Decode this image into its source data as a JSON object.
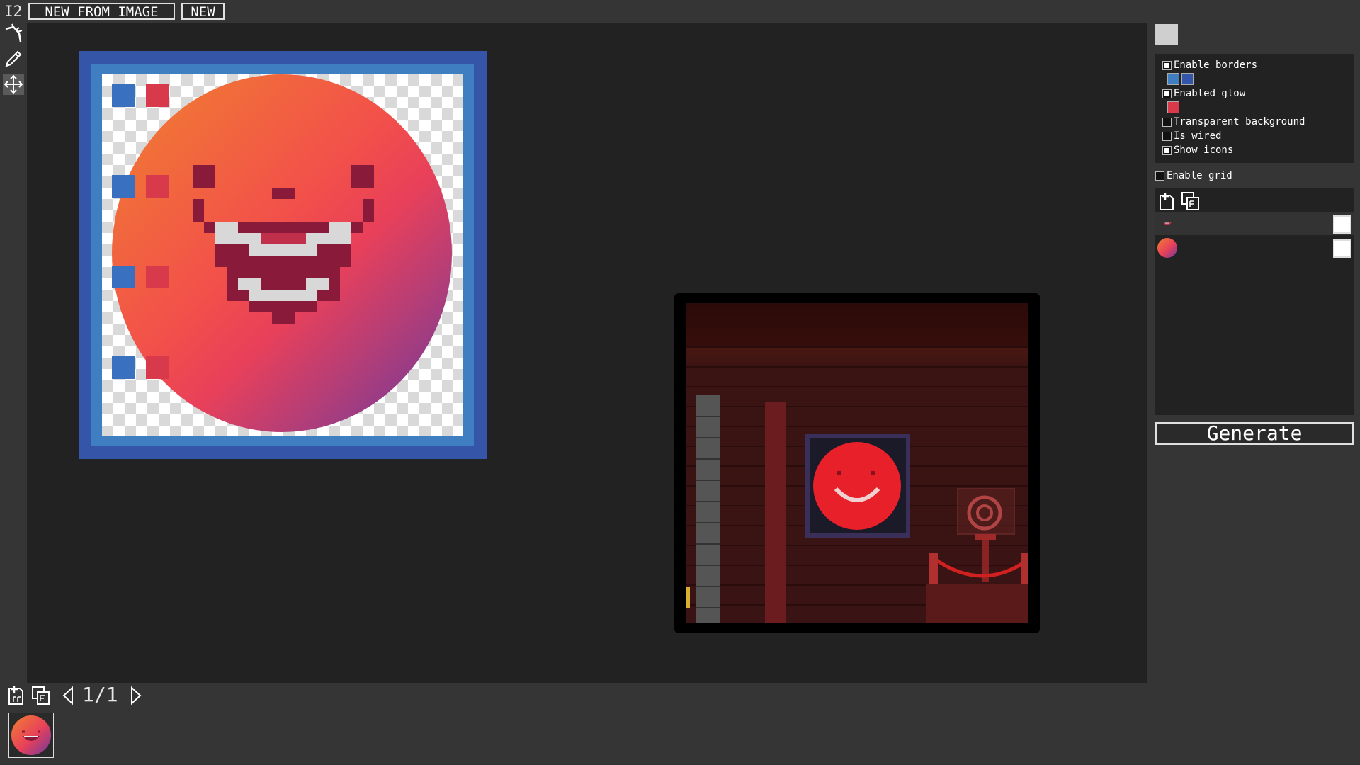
{
  "header": {
    "app_label": "I2",
    "new_from_image_label": "NEW FROM IMAGE",
    "new_label": "NEW"
  },
  "toolbar": {
    "tools": [
      {
        "name": "magic-wand-icon",
        "active": false
      },
      {
        "name": "pencil-icon",
        "active": false
      },
      {
        "name": "move-icon",
        "active": true
      }
    ]
  },
  "options": {
    "enable_borders_label": "Enable borders",
    "enable_borders": true,
    "border_colors": [
      "#3f7fc1",
      "#3556a8"
    ],
    "enabled_glow_label": "Enabled glow",
    "enabled_glow": true,
    "glow_color": "#d83a4c",
    "transparent_background_label": "Transparent background",
    "transparent_background": false,
    "is_wired_label": "Is wired",
    "is_wired": false,
    "show_icons_label": "Show icons",
    "show_icons": true,
    "enable_grid_label": "Enable grid",
    "enable_grid": false
  },
  "layers": {
    "items": [
      {
        "name": "face",
        "visible": true,
        "selected": true
      },
      {
        "name": "ball",
        "visible": true,
        "selected": false
      }
    ]
  },
  "generate_label": "Generate",
  "pager": {
    "text": "1/1"
  },
  "colors": {
    "canvas_bg": "#222222",
    "panel_bg": "#353535",
    "border_outer": "#3556a8",
    "border_inner": "#3f7fc1",
    "glow": "#d83a4c"
  }
}
